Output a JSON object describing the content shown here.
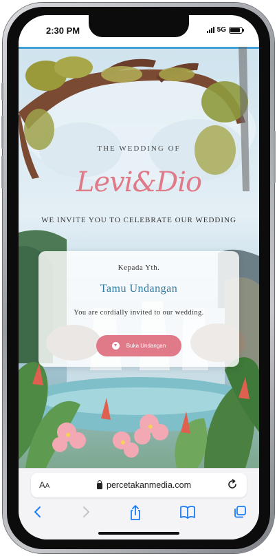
{
  "status_bar": {
    "time": "2:30 PM",
    "network": "5G",
    "battery_level": 0.85
  },
  "invitation": {
    "header": "THE WEDDING OF",
    "couple_names": "Levi&Dio",
    "invite_line": "WE INVITE YOU TO CELEBRATE OUR WEDDING",
    "card": {
      "greeting": "Kepada Yth.",
      "guest_name": "Tamu Undangan",
      "message": "You are cordially invited to our wedding.",
      "button_label": "Buka Undangan"
    }
  },
  "browser": {
    "aa_label_large": "A",
    "aa_label_small": "A",
    "url": "percetakanmedia.com",
    "icons": [
      "lock-icon",
      "reload-icon",
      "back-icon",
      "forward-icon",
      "share-icon",
      "bookmarks-icon",
      "tabs-icon"
    ]
  },
  "colors": {
    "accent_pink": "#e07a89",
    "accent_blue": "#2e7a9e",
    "link_blue": "#1a7cf5"
  }
}
